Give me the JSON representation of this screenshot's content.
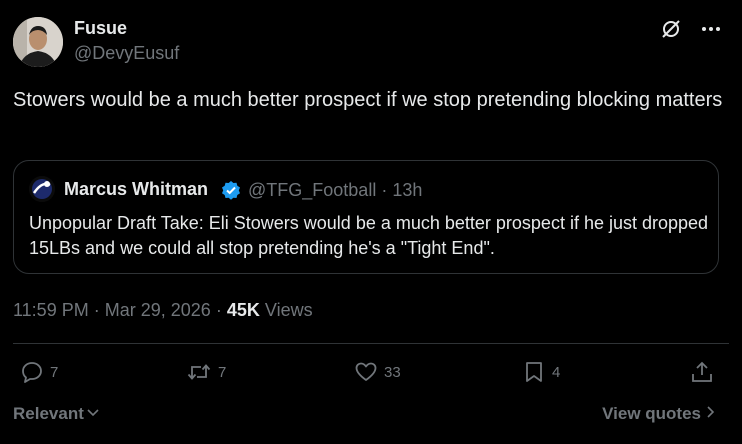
{
  "author": {
    "name": "Fusue",
    "handle": "@DevyEusuf"
  },
  "tweet": {
    "text": "Stowers would be a much better prospect if we stop pretending blocking matters"
  },
  "quoted": {
    "name": "Marcus Whitman",
    "handle": "@TFG_Football",
    "separator": "·",
    "age": "13h",
    "text": "Unpopular Draft Take: Eli Stowers would be a much better prospect if he just dropped 15LBs and we could all stop pretending he's a \"Tight End\"."
  },
  "meta": {
    "time": "11:59 PM",
    "separator": "·",
    "date": "Mar 29, 2026",
    "separator2": "·",
    "views_count": "45K",
    "views_label": "Views"
  },
  "actions": {
    "replies": "7",
    "reposts": "7",
    "likes": "33",
    "bookmarks": "4"
  },
  "footer": {
    "sort_label": "Relevant",
    "view_quotes_label": "View quotes"
  },
  "colors": {
    "background": "#000000",
    "text": "#e7e9ea",
    "muted": "#71767b",
    "border": "#2f3336",
    "verified": "#1d9bf0"
  },
  "icons": [
    "no-grok-icon",
    "more-icon",
    "reply-icon",
    "repost-icon",
    "like-icon",
    "bookmark-icon",
    "share-icon",
    "chevron-down-icon",
    "chevron-right-icon",
    "verified-badge-icon"
  ]
}
